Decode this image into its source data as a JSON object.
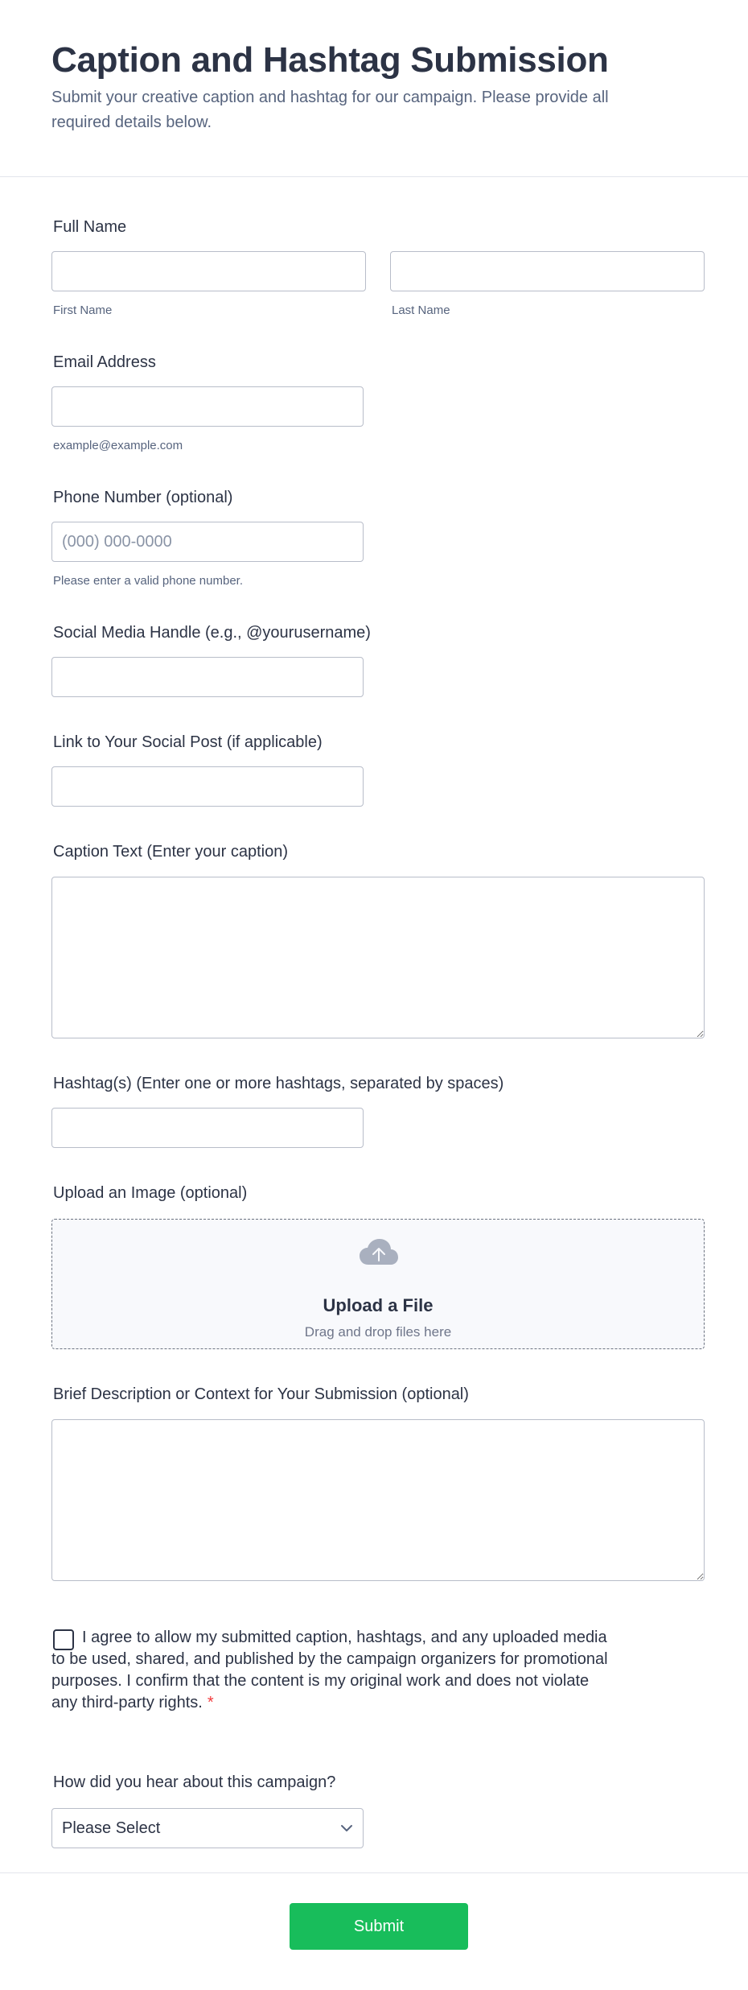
{
  "header": {
    "title": "Caption and Hashtag Submission",
    "subtitle": "Submit your creative caption and hashtag for our campaign. Please provide all required details below."
  },
  "fields": {
    "full_name": {
      "label": "Full Name",
      "first_sublabel": "First Name",
      "last_sublabel": "Last Name",
      "first_value": "",
      "last_value": ""
    },
    "email": {
      "label": "Email Address",
      "sublabel": "example@example.com",
      "value": ""
    },
    "phone": {
      "label": "Phone Number (optional)",
      "placeholder": "(000) 000-0000",
      "sublabel": "Please enter a valid phone number.",
      "value": ""
    },
    "social_handle": {
      "label": "Social Media Handle (e.g., @yourusername)",
      "value": ""
    },
    "social_link": {
      "label": "Link to Your Social Post (if applicable)",
      "value": ""
    },
    "caption": {
      "label": "Caption Text (Enter your caption)",
      "value": ""
    },
    "hashtags": {
      "label": "Hashtag(s) (Enter one or more hashtags, separated by spaces)",
      "value": ""
    },
    "upload": {
      "label": "Upload an Image (optional)",
      "title": "Upload a File",
      "subtitle": "Drag and drop files here",
      "icon": "cloud-upload-icon"
    },
    "description": {
      "label": "Brief Description or Context for Your Submission (optional)",
      "value": ""
    },
    "consent": {
      "text": "I agree to allow my submitted caption, hashtags, and any uploaded media to be used, shared, and published by the campaign organizers for promotional purposes. I confirm that the content is my original work and does not violate any third-party rights.",
      "required_mark": "*",
      "checked": false
    },
    "source": {
      "label": "How did you hear about this campaign?",
      "selected": "Please Select"
    }
  },
  "footer": {
    "submit_label": "Submit"
  },
  "colors": {
    "accent": "#18bd5b",
    "required": "#f23a3c",
    "text": "#2c3345",
    "muted": "#57647e"
  }
}
